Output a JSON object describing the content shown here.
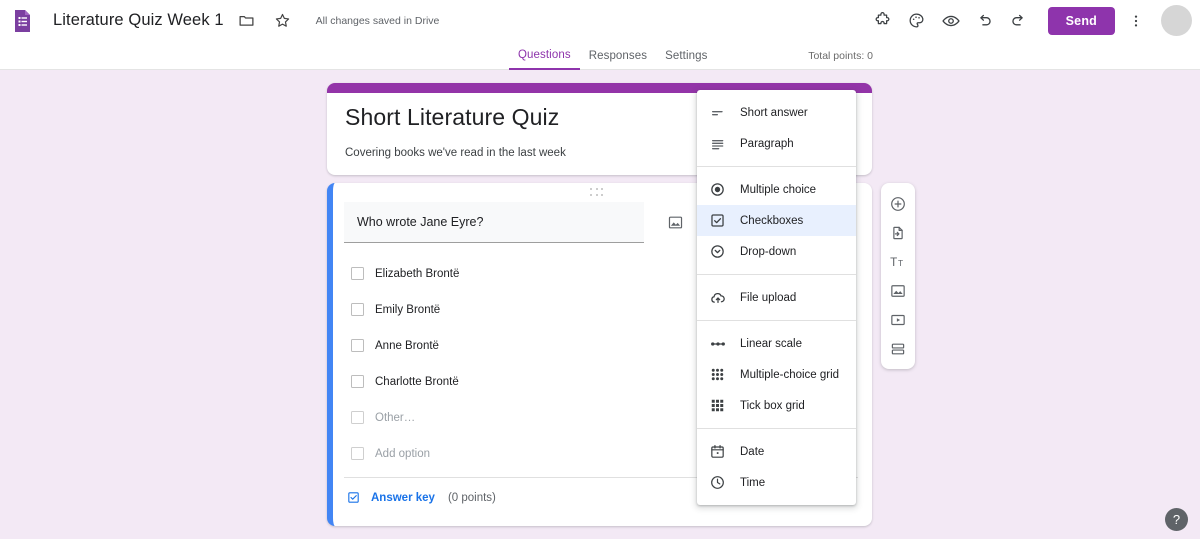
{
  "app": {
    "logo_icon": "google-forms-logo-icon",
    "doc_title": "Literature Quiz Week 1",
    "folder_icon": "folder-icon",
    "star_icon": "star-icon",
    "save_status": "All changes saved in Drive"
  },
  "toolbar": {
    "addons_icon": "puzzle-piece-icon",
    "theme_icon": "palette-icon",
    "preview_icon": "eye-icon",
    "undo_icon": "undo-icon",
    "redo_icon": "redo-icon",
    "send_label": "Send",
    "more_icon": "more-vert-icon",
    "avatar": "account-avatar"
  },
  "tabs": {
    "items": [
      {
        "label": "Questions",
        "active": true
      },
      {
        "label": "Responses",
        "active": false
      },
      {
        "label": "Settings",
        "active": false
      }
    ],
    "total_points": "Total points: 0"
  },
  "form": {
    "title": "Short Literature Quiz",
    "description": "Covering books we've read in the last week",
    "accent_color": "#9334A8"
  },
  "question": {
    "drag_handle_icon": "drag-handle-icon",
    "text": "Who wrote Jane Eyre?",
    "image_icon": "add-image-icon",
    "active_border_color": "#4285F4",
    "options": [
      {
        "label": "Elizabeth Brontë",
        "muted": false
      },
      {
        "label": "Emily Brontë",
        "muted": false
      },
      {
        "label": "Anne Brontë",
        "muted": false
      },
      {
        "label": "Charlotte Brontë",
        "muted": false
      },
      {
        "label": "Other…",
        "muted": true
      },
      {
        "label": "Add option",
        "muted": true
      }
    ],
    "answer_key_icon": "answer-key-icon",
    "answer_key_label": "Answer key",
    "points_label": "(0 points)",
    "duplicate_icon": "duplicate-icon"
  },
  "side_toolbar": {
    "items": [
      {
        "icon": "add-question-icon"
      },
      {
        "icon": "import-questions-icon"
      },
      {
        "icon": "add-title-icon"
      },
      {
        "icon": "add-image-icon"
      },
      {
        "icon": "add-video-icon"
      },
      {
        "icon": "add-section-icon"
      }
    ]
  },
  "type_menu": {
    "groups": [
      {
        "items": [
          {
            "label": "Short answer",
            "icon": "short-answer-icon",
            "selected": false
          },
          {
            "label": "Paragraph",
            "icon": "paragraph-icon",
            "selected": false
          }
        ]
      },
      {
        "items": [
          {
            "label": "Multiple choice",
            "icon": "radio-icon",
            "selected": false
          },
          {
            "label": "Checkboxes",
            "icon": "checkbox-icon",
            "selected": true
          },
          {
            "label": "Drop-down",
            "icon": "chevron-down-circle-icon",
            "selected": false
          }
        ]
      },
      {
        "items": [
          {
            "label": "File upload",
            "icon": "cloud-upload-icon",
            "selected": false
          }
        ]
      },
      {
        "items": [
          {
            "label": "Linear scale",
            "icon": "linear-scale-icon",
            "selected": false
          },
          {
            "label": "Multiple-choice grid",
            "icon": "radio-grid-icon",
            "selected": false
          },
          {
            "label": "Tick box grid",
            "icon": "checkbox-grid-icon",
            "selected": false
          }
        ]
      },
      {
        "items": [
          {
            "label": "Date",
            "icon": "calendar-icon",
            "selected": false
          },
          {
            "label": "Time",
            "icon": "clock-icon",
            "selected": false
          }
        ]
      }
    ]
  },
  "help": {
    "icon": "help-icon",
    "label": "?"
  }
}
